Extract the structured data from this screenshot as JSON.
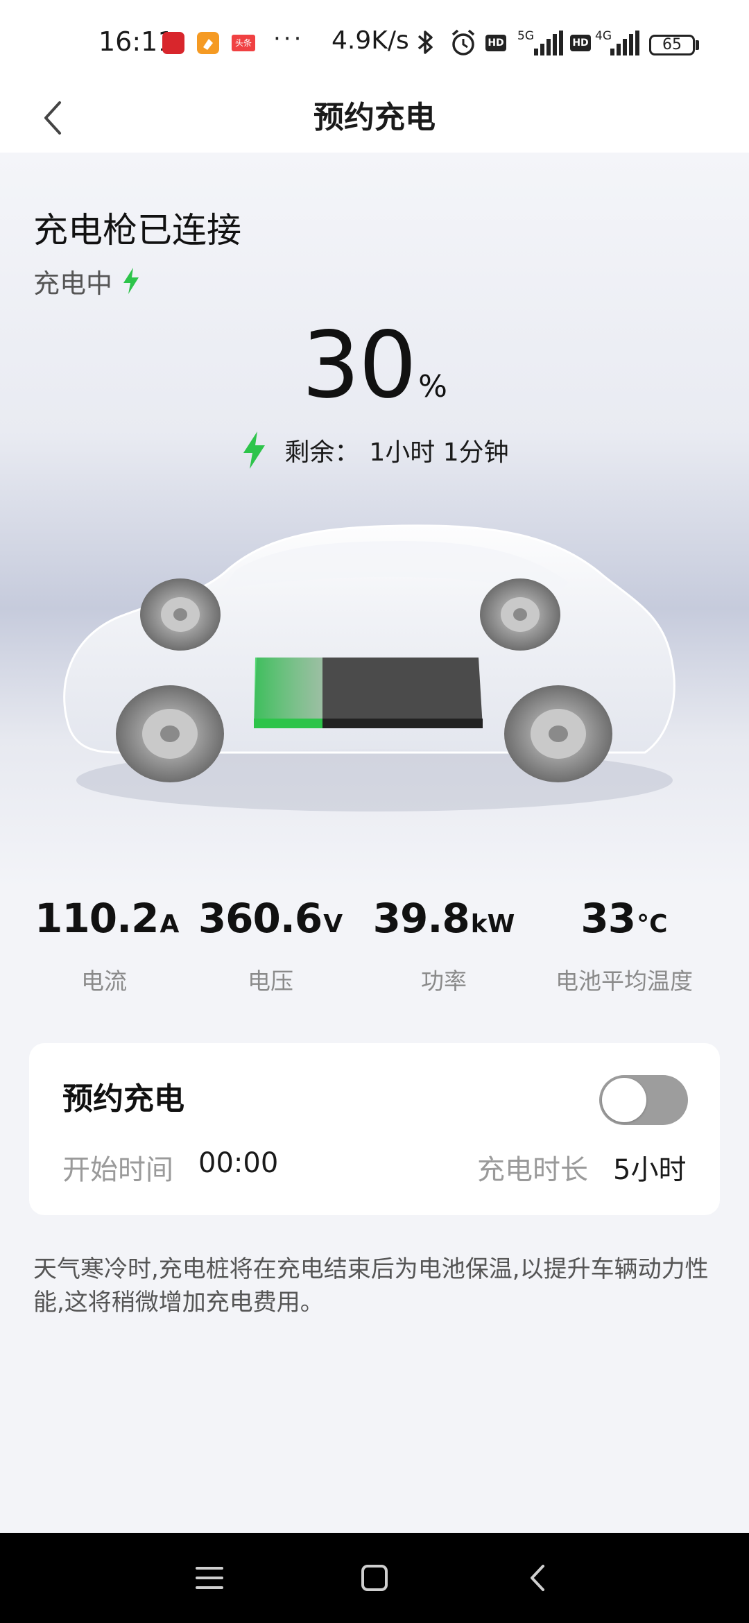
{
  "status_bar": {
    "time": "16:11",
    "apps": [
      "red-app-icon",
      "orange-app-icon",
      "toutiao-app-icon"
    ],
    "toutiao_label": "头条",
    "more": "···",
    "net_speed": "4.9K/s",
    "sim1": {
      "hd": "HD",
      "network": "5G"
    },
    "sim2": {
      "hd": "HD",
      "network": "4G"
    },
    "battery": "65"
  },
  "header": {
    "title": "预约充电",
    "back_icon": "chevron-left-icon"
  },
  "charging": {
    "connection_title": "充电枪已连接",
    "status": "充电中",
    "percent": "30",
    "percent_unit": "%",
    "percent_value": 30,
    "remaining_label": "剩余：",
    "remaining_value": "1小时 1分钟",
    "accent_color": "#2dc44a"
  },
  "stats": [
    {
      "value": "110.2",
      "unit": "A",
      "label": "电流"
    },
    {
      "value": "360.6",
      "unit": "V",
      "label": "电压"
    },
    {
      "value": "39.8",
      "unit": "kW",
      "label": "功率"
    },
    {
      "value": "33",
      "unit": "°C",
      "label": "电池平均温度"
    }
  ],
  "schedule": {
    "title": "预约充电",
    "enabled": false,
    "start_label": "开始时间",
    "start_value": "00:00",
    "duration_label": "充电时长",
    "duration_value": "5小时"
  },
  "note": "天气寒冷时,充电桩将在充电结束后为电池保温,以提升车辆动力性能,这将稍微增加充电费用。",
  "bottom_nav": [
    "menu-icon",
    "home-icon",
    "back-icon"
  ]
}
